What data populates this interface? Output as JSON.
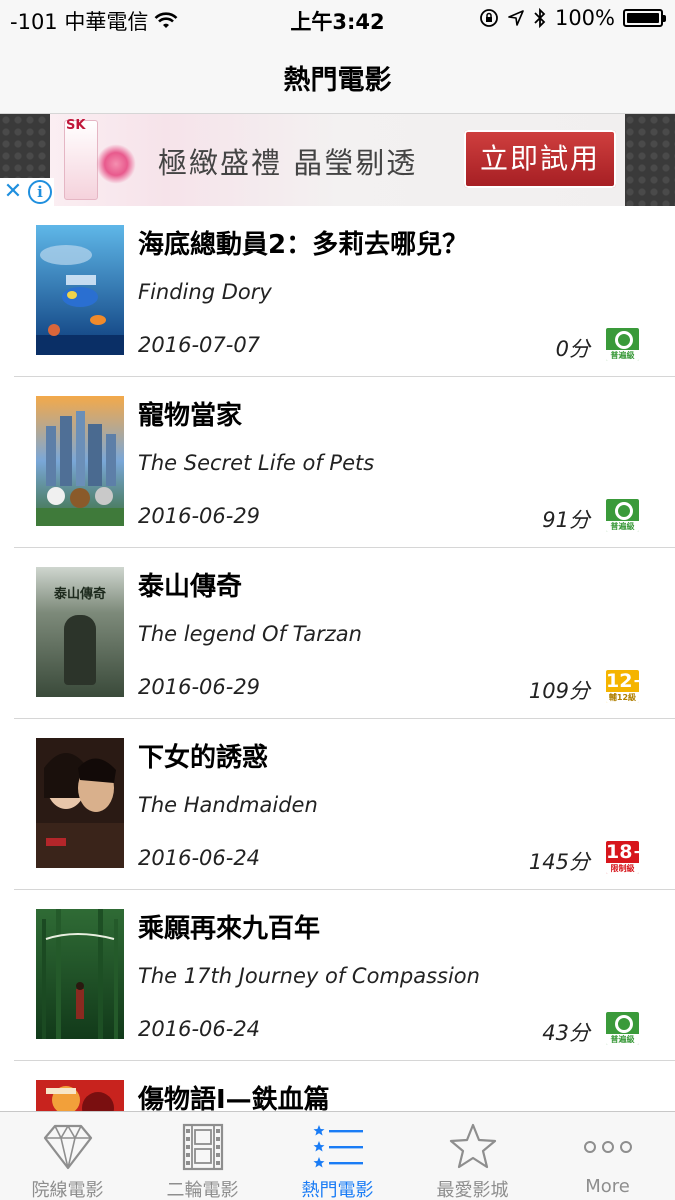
{
  "status": {
    "carrier": "-101 中華電信",
    "time": "上午3:42",
    "battery": "100%",
    "battery_level": 1.0
  },
  "nav": {
    "title": "熱門電影"
  },
  "ad": {
    "brand": "SK",
    "headline": "極緻盛禮 晶瑩剔透",
    "cta": "立即試用",
    "close_glyph": "✕",
    "info_glyph": "i"
  },
  "movies": [
    {
      "title_zh": "海底總動員2：多莉去哪兒？",
      "title_en": "Finding Dory",
      "date": "2016-07-07",
      "runtime": "0分",
      "rating": "general",
      "rating_label": "普遍級",
      "poster_icon": "finding-dory-poster"
    },
    {
      "title_zh": "寵物當家",
      "title_en": "The Secret Life of Pets",
      "date": "2016-06-29",
      "runtime": "91分",
      "rating": "general",
      "rating_label": "普遍級",
      "poster_icon": "secret-life-of-pets-poster"
    },
    {
      "title_zh": "泰山傳奇",
      "title_en": "The legend Of Tarzan",
      "date": "2016-06-29",
      "runtime": "109分",
      "rating": "pg12",
      "rating_mark": "12+",
      "rating_label": "輔12級",
      "poster_icon": "tarzan-poster",
      "poster_text": "泰山傳奇"
    },
    {
      "title_zh": "下女的誘惑",
      "title_en": "The Handmaiden",
      "date": "2016-06-24",
      "runtime": "145分",
      "rating": "r18",
      "rating_mark": "18+",
      "rating_label": "限制級",
      "poster_icon": "handmaiden-poster"
    },
    {
      "title_zh": "乘願再來九百年",
      "title_en": "The 17th Journey of Compassion",
      "date": "2016-06-24",
      "runtime": "43分",
      "rating": "general",
      "rating_label": "普遍級",
      "poster_icon": "compassion-poster"
    },
    {
      "title_zh": "傷物語I—鉄血篇",
      "title_en": "",
      "date": "",
      "runtime": "",
      "rating": "",
      "rating_label": "",
      "poster_icon": "kizumonogatari-poster"
    }
  ],
  "tabs": [
    {
      "label": "院線電影",
      "icon": "diamond-icon",
      "active": false
    },
    {
      "label": "二輪電影",
      "icon": "film-strip-icon",
      "active": false
    },
    {
      "label": "熱門電影",
      "icon": "star-list-icon",
      "active": true
    },
    {
      "label": "最愛影城",
      "icon": "star-icon",
      "active": false
    },
    {
      "label": "More",
      "icon": "more-dots-icon",
      "active": false
    }
  ],
  "colors": {
    "accent": "#1a7cf5",
    "tab_inactive": "#8e8e8e",
    "general": "#3a9a3a",
    "pg12": "#f5b400",
    "r18": "#d7161c"
  }
}
